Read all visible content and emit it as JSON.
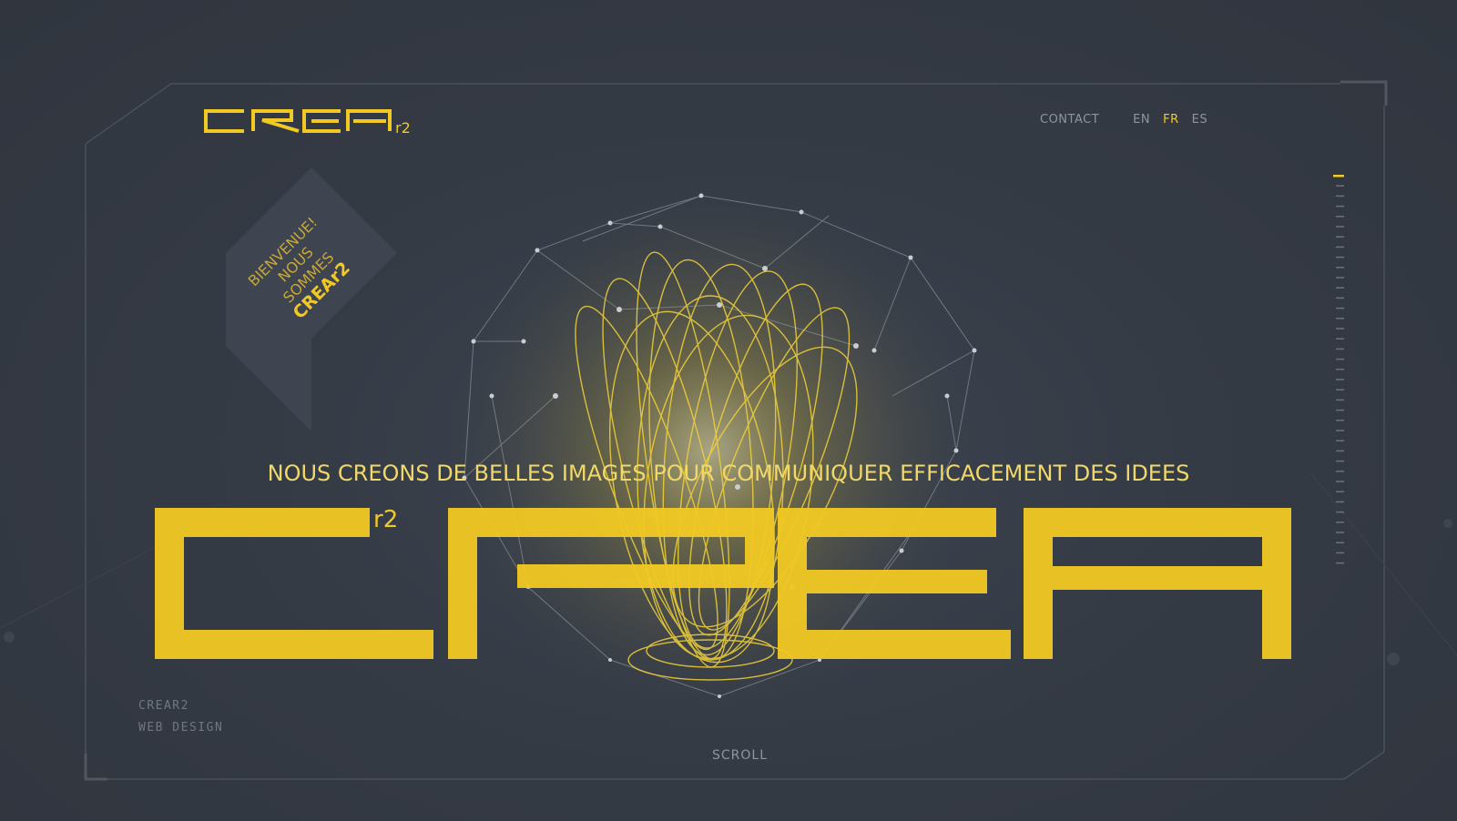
{
  "brand": {
    "logo_text": "CREAr2",
    "logo_suffix": "r2"
  },
  "nav": {
    "contact_label": "CONTACT",
    "languages": [
      {
        "code": "EN",
        "active": false
      },
      {
        "code": "FR",
        "active": true
      },
      {
        "code": "ES",
        "active": false
      }
    ]
  },
  "welcome": {
    "lines": [
      "BIENVENUE!",
      "NOUS",
      "SOMMES",
      "CREAr2"
    ]
  },
  "hero": {
    "tagline": "NOUS CREONS DE BELLES IMAGES POUR COMMUNIQUER EFFICACEMENT DES IDEES",
    "big_text": "CREA",
    "superscript": "r2"
  },
  "footer": {
    "caption_line1": "CREAR2",
    "caption_line2": "WEB DESIGN",
    "scroll_label": "SCROLL"
  },
  "colors": {
    "background": "#353b45",
    "accent": "#f2c924",
    "muted_text": "#8c95a3",
    "frame_line": "#4a515c"
  },
  "icons": {
    "logo": "crear2-logo-icon",
    "badge": "diamond-badge-icon",
    "scroll_indicator": "scroll-ticks-icon"
  }
}
